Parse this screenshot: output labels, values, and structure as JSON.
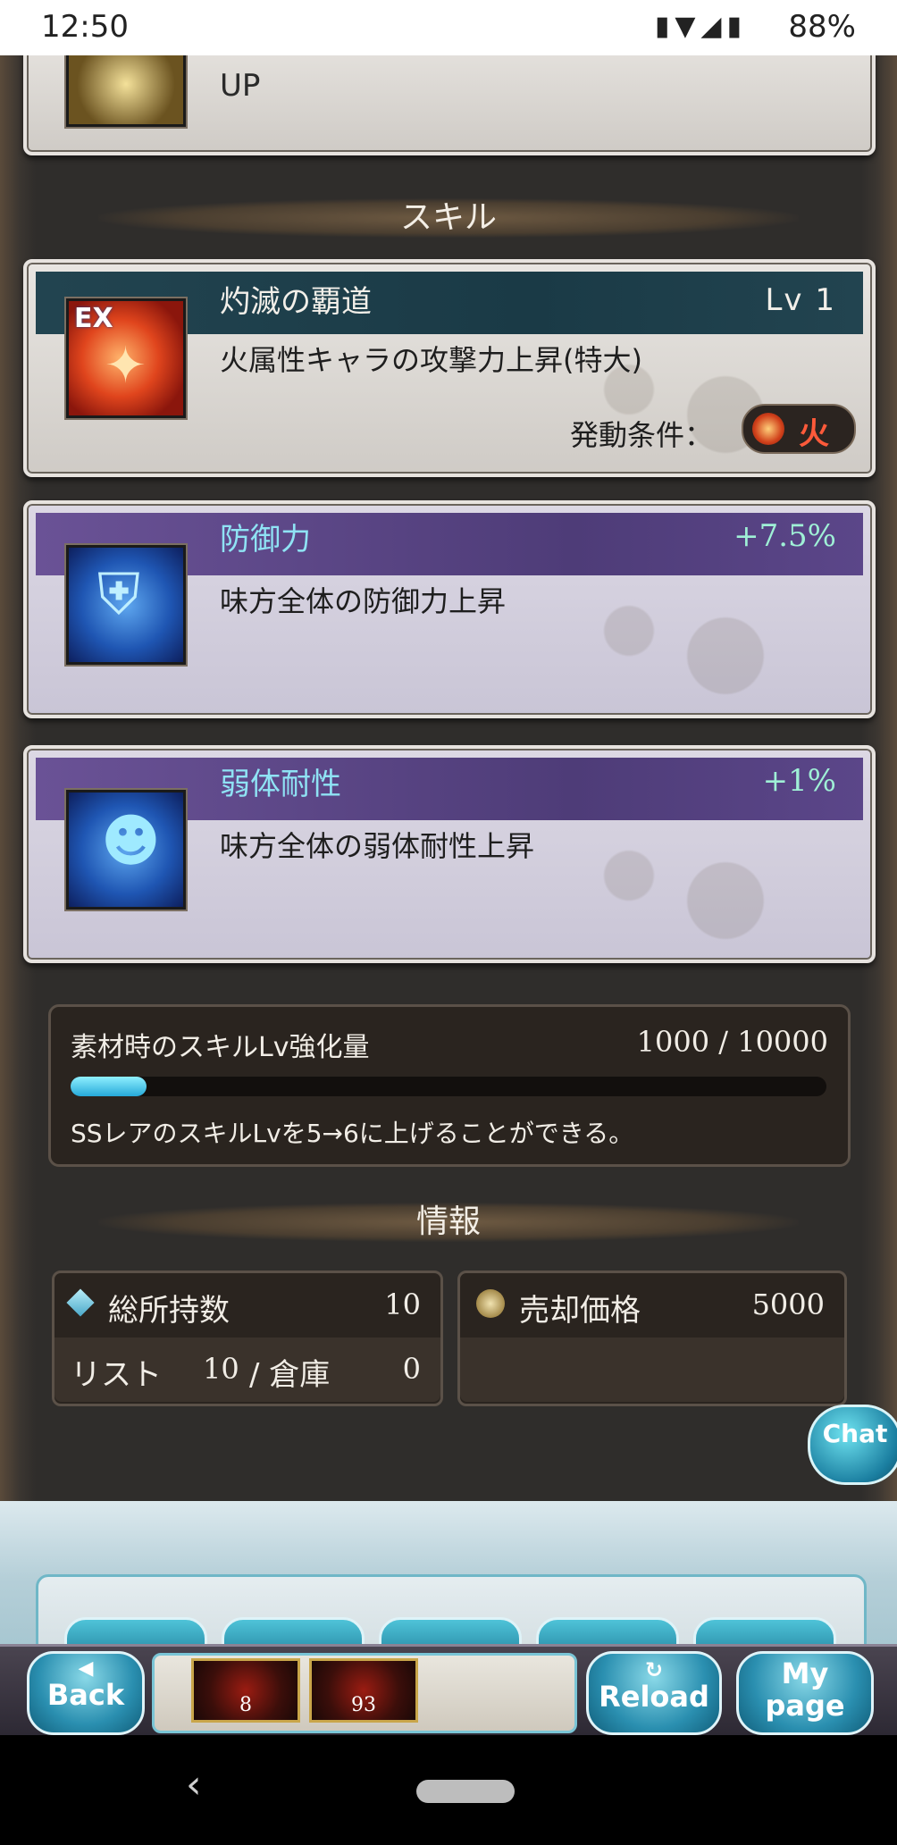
{
  "status": {
    "time": "12:50",
    "battery": "88%"
  },
  "top_panel": {
    "partial_text": "UP"
  },
  "sections": {
    "skill": "スキル",
    "info": "情報"
  },
  "skills": [
    {
      "name": "灼滅の覇道",
      "level": "Lv 1",
      "desc": "火属性キャラの攻撃力上昇(特大)",
      "condition_label": "発動条件：",
      "condition_value": "火",
      "icon_badge": "EX"
    },
    {
      "name": "防御力",
      "bonus": "+7.5%",
      "desc": "味方全体の防御力上昇"
    },
    {
      "name": "弱体耐性",
      "bonus": "+1%",
      "desc": "味方全体の弱体耐性上昇"
    }
  ],
  "material": {
    "label": "素材時のスキルLv強化量",
    "value": "1000 / 10000",
    "progress": 0.1,
    "note": "SSレアのスキルLvを5→6に上げることができる。"
  },
  "info": {
    "total_label": "総所持数",
    "total_value": "10",
    "list_label": "リスト",
    "list_value": "10",
    "storage_label": "/ 倉庫",
    "storage_value": "0",
    "sell_label": "売却価格",
    "sell_value": "5000"
  },
  "chat_label": "Chat",
  "nav": {
    "back": "Back",
    "reload": "Reload",
    "mypage_line1": "My",
    "mypage_line2": "page",
    "slot1": "8",
    "slot2": "93"
  },
  "colors": {
    "fire": "#c0341a",
    "blue_icon": "#1f56b3",
    "accent_cyan": "#8fe3f4"
  }
}
